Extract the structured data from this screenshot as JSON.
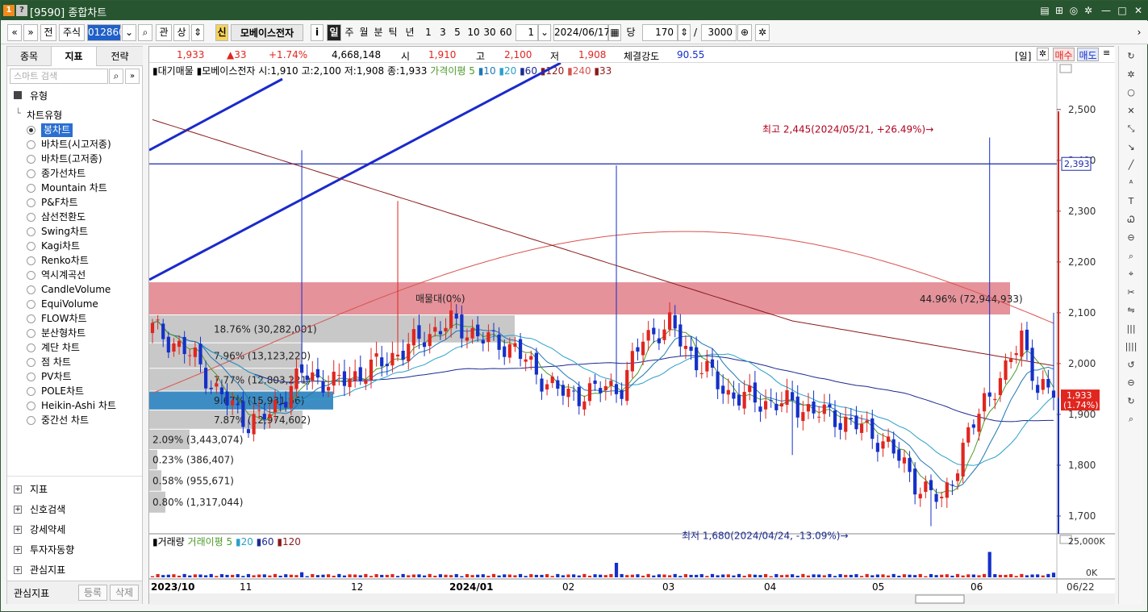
{
  "window": {
    "title": "[9590] 종합차트"
  },
  "toolbar": {
    "nav_prev": "«",
    "nav_down": "»",
    "jeon": "전",
    "category": "주식",
    "code": "012860",
    "gwan": "관",
    "sang": "상",
    "sin": "신",
    "company": "모베이스전자",
    "info": "i",
    "periods": [
      "일",
      "주",
      "월",
      "분",
      "틱",
      "년"
    ],
    "intervals": [
      "1",
      "3",
      "5",
      "10",
      "30",
      "60"
    ],
    "count_sel": "1",
    "date": "2024/06/17",
    "dang": "당",
    "bars": "170",
    "slash": "/",
    "total": "3000"
  },
  "left": {
    "tabs": [
      "종목",
      "지표",
      "전략"
    ],
    "search_placeholder": "스마트 검색",
    "section": "유형",
    "tree_root": "차트유형",
    "chart_types": [
      "봉차트",
      "바차트(시고저종)",
      "바차트(고저종)",
      "종가선차트",
      "Mountain 차트",
      "P&F차트",
      "삼선전환도",
      "Swing차트",
      "Kagi차트",
      "Renko차트",
      "역시계곡선",
      "CandleVolume",
      "EquiVolume",
      "FLOW차트",
      "분산형차트",
      "계단 차트",
      "점 차트",
      "PV차트",
      "POLE차트",
      "Heikin-Ashi 차트",
      "중간선 차트"
    ],
    "groups": [
      "지표",
      "신호검색",
      "강세약세",
      "투자자동향",
      "관심지표"
    ],
    "bottom_label": "관심지표",
    "register": "등록",
    "delete": "삭제"
  },
  "quote": {
    "price": "1,933",
    "change": "▲33",
    "pct": "+1.74%",
    "volume": "4,668,148",
    "open_label": "시",
    "open": "1,910",
    "high_label": "고",
    "high": "2,100",
    "low_label": "저",
    "low": "1,908",
    "strength_label": "체결강도",
    "strength": "90.55",
    "day_label": "[일]",
    "buy": "매수",
    "sell": "매도"
  },
  "colors": {
    "up": "#e0261f",
    "down": "#1530c8",
    "ma5": "#4c9a2a",
    "ma10": "#1f77b4",
    "ma20": "#2aa0c8",
    "ma60": "#1c2a8f",
    "ma120": "#8b1a1a",
    "ma240": "#d9534f"
  },
  "chart_data": {
    "type": "candlestick",
    "legend": "▮대기매물 ▮모베이스전자 시:1,910 고:2,100 저:1,908 종:1,933 ▮가격이평 5 ▮10 ▮20 ▮60 ▮120 ▮240 ▮33",
    "legend_title": "▮대기매물",
    "legend_stock": "▮모베이스전자 시:1,910 고:2,100 저:1,908 종:1,933",
    "legend_ma_label": "가격이평",
    "legend_ma": [
      "5",
      "10",
      "20",
      "60",
      "120",
      "240",
      "33"
    ],
    "y_ticks": [
      "2,500",
      "2,400",
      "2,300",
      "2,200",
      "2,100",
      "2,000",
      "1,900",
      "1,800",
      "1,700"
    ],
    "y_values": [
      2500,
      2400,
      2300,
      2200,
      2100,
      2000,
      1900,
      1800,
      1700
    ],
    "ylim": [
      1665,
      2560
    ],
    "x_ticks": [
      "2023/10",
      "11",
      "12",
      "2024/01",
      "02",
      "03",
      "04",
      "05",
      "06"
    ],
    "x_end": "06/22",
    "current_label": "1,933",
    "current_pct": "(1.74%)",
    "hline_label": "2,393",
    "max_note": "최고 2,445(2024/05/21, +26.49%)→",
    "min_note": "최저 1,680(2024/04/24, -13.09%)→",
    "overhang": [
      {
        "pct": "",
        "label": "매물대(0%)",
        "lo": 2095,
        "hi": 2160,
        "hl": true
      },
      {
        "pct": "18.7%",
        "label": "18.76% (30,282,001)",
        "lo": 2040,
        "hi": 2095
      },
      {
        "pct": "7.96%",
        "label": "7.96% (13,123,220)",
        "lo": 1990,
        "hi": 2040
      },
      {
        "pct": "7.77%",
        "label": "7.77% (12,803,221)",
        "lo": 1945,
        "hi": 1990
      },
      {
        "pct": "9.67%",
        "label": "9.67% (15,931,56)",
        "lo": 1908,
        "hi": 1945,
        "blue": true
      },
      {
        "pct": "7.87%",
        "label": "7.87% (12,974,602)",
        "lo": 1870,
        "hi": 1908
      },
      {
        "pct": "2.09%",
        "label": "2.09% (3,443,074)",
        "lo": 1830,
        "hi": 1870
      },
      {
        "pct": "0.23%",
        "label": "0.23% (386,407)",
        "lo": 1790,
        "hi": 1830
      },
      {
        "pct": "0.58%",
        "label": "0.58% (955,671)",
        "lo": 1748,
        "hi": 1790
      },
      {
        "pct": "0.80%",
        "label": "0.80% (1,317,044)",
        "lo": 1705,
        "hi": 1748
      }
    ],
    "top_zone_label": "44.96% (72,944,933)",
    "volume_legend": "▮거래량 ▮거래이평 5 ▮20 ▮60 ▮120",
    "vol_title": "▮거래량",
    "vol_ma_label": "거래이평",
    "vol_ma": [
      "5",
      "20",
      "60",
      "120"
    ],
    "vol_ticks": [
      "25,000K",
      "0K"
    ]
  }
}
